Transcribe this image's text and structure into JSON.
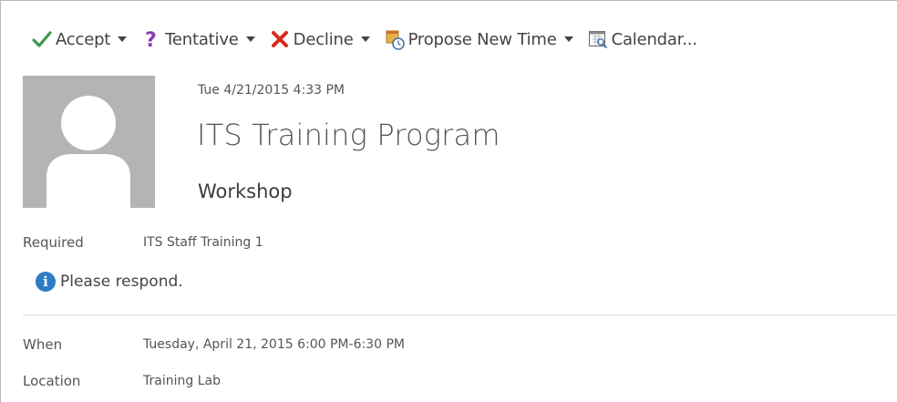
{
  "toolbar": {
    "accept_label": "Accept",
    "tentative_label": "Tentative",
    "decline_label": "Decline",
    "propose_label": "Propose New Time",
    "calendar_label": "Calendar..."
  },
  "message": {
    "sent": "Tue 4/21/2015 4:33 PM",
    "subject": "ITS Training Program",
    "category": "Workshop"
  },
  "required": {
    "label": "Required",
    "value": "ITS Staff Training 1"
  },
  "info_bar": {
    "icon": "info-icon",
    "text": "Please respond."
  },
  "details": {
    "when_label": "When",
    "when_value": "Tuesday, April 21, 2015 6:00 PM-6:30 PM",
    "location_label": "Location",
    "location_value": "Training Lab"
  },
  "colors": {
    "accept": "#3a9a4a",
    "tentative": "#8a3db0",
    "decline": "#d9291c",
    "info": "#2f7cc4",
    "avatar_bg": "#b4b4b4"
  }
}
